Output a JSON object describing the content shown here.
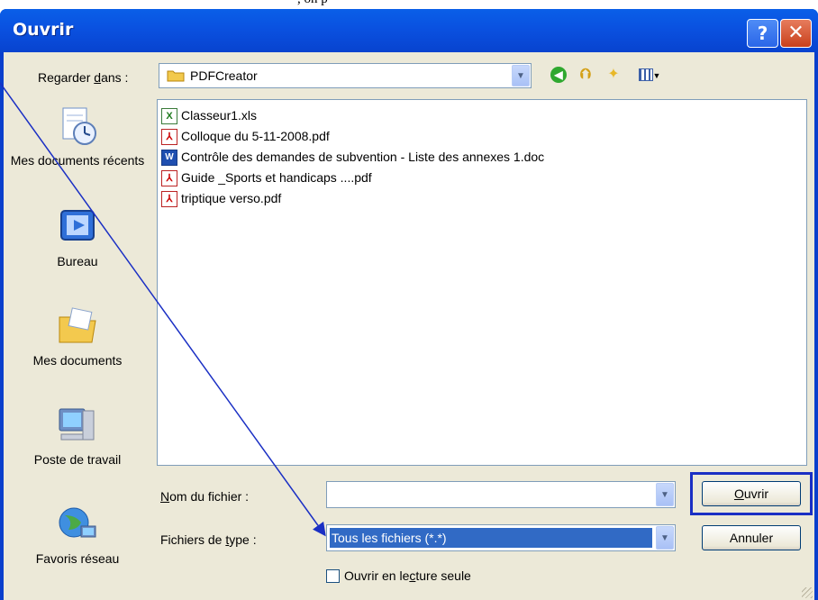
{
  "top_text": ", on p",
  "window": {
    "title": "Ouvrir",
    "help_glyph": "?",
    "close_glyph": "✕"
  },
  "look_in": {
    "label_pre": "Regarder ",
    "label_key": "d",
    "label_post": "ans :",
    "value": "PDFCreator"
  },
  "toolbar": {
    "back_icon": "arrow-left-icon",
    "up_icon": "folder-up-icon",
    "new_folder_icon": "new-folder-icon",
    "views_icon": "views-menu-icon"
  },
  "places": [
    {
      "label": "Mes documents récents",
      "icon": "recent-documents-icon"
    },
    {
      "label": "Bureau",
      "icon": "desktop-icon"
    },
    {
      "label": "Mes documents",
      "icon": "my-documents-icon"
    },
    {
      "label": "Poste de travail",
      "icon": "my-computer-icon"
    },
    {
      "label": "Favoris réseau",
      "icon": "network-places-icon"
    }
  ],
  "files": [
    {
      "name": "Classeur1.xls",
      "type": "xls",
      "glyph": "X"
    },
    {
      "name": "Colloque du 5-11-2008.pdf",
      "type": "pdf",
      "glyph": "⅄"
    },
    {
      "name": "Contrôle des demandes de subvention - Liste des annexes 1.doc",
      "type": "doc",
      "glyph": "W"
    },
    {
      "name": "Guide _Sports et handicaps ....pdf",
      "type": "pdf",
      "glyph": "⅄"
    },
    {
      "name": "triptique verso.pdf",
      "type": "pdf",
      "glyph": "⅄"
    }
  ],
  "filename": {
    "label_pre": "",
    "label_key": "N",
    "label_post": "om du fichier :",
    "value": ""
  },
  "filetype": {
    "label_pre": "Fichiers de ",
    "label_key": "t",
    "label_post": "ype :",
    "value": "Tous les fichiers (*.*)"
  },
  "buttons": {
    "open_key": "O",
    "open_rest": "uvrir",
    "cancel": "Annuler"
  },
  "readonly": {
    "label_pre": "Ouvrir en le",
    "label_key": "c",
    "label_post": "ture seule",
    "checked": false
  },
  "colors": {
    "title_bar": "#0a51e0",
    "face": "#ece9d8",
    "selection": "#316ac5",
    "annotation": "#1a2fc4"
  }
}
